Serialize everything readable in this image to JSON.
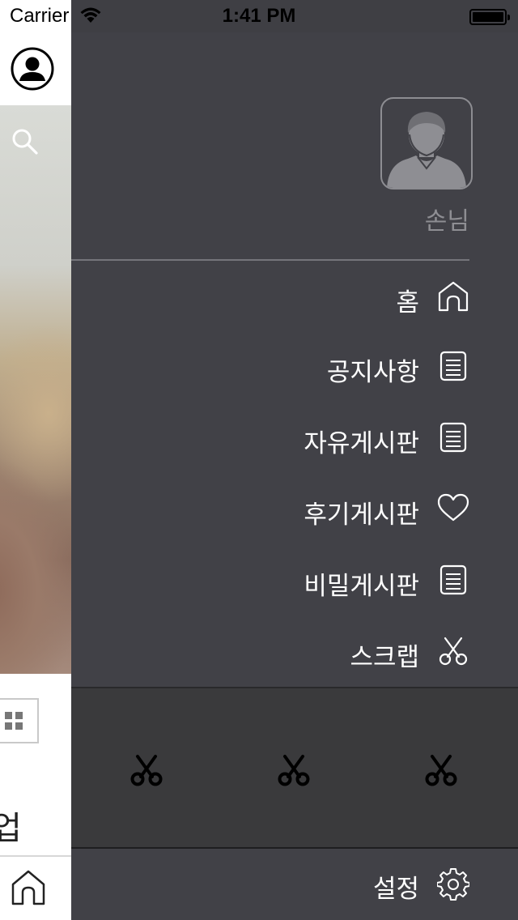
{
  "status_bar": {
    "carrier": "Carrier",
    "time": "1:41 PM"
  },
  "drawer": {
    "user_name": "손님",
    "menu": [
      {
        "label": "홈",
        "icon": "home-icon"
      },
      {
        "label": "공지사항",
        "icon": "document-icon"
      },
      {
        "label": "자유게시판",
        "icon": "document-icon"
      },
      {
        "label": "후기게시판",
        "icon": "heart-icon"
      },
      {
        "label": "비밀게시판",
        "icon": "document-icon"
      },
      {
        "label": "스크랩",
        "icon": "scissors-icon"
      }
    ],
    "scrap_slots": [
      "scissors-icon",
      "scissors-icon",
      "scissors-icon"
    ],
    "settings_label": "설정"
  },
  "background_page": {
    "partial_text": "업"
  },
  "colors": {
    "drawer_bg": "#414147",
    "scrap_panel_bg": "#3a3a3c",
    "text": "#ffffff",
    "muted": "#8e8e93"
  }
}
